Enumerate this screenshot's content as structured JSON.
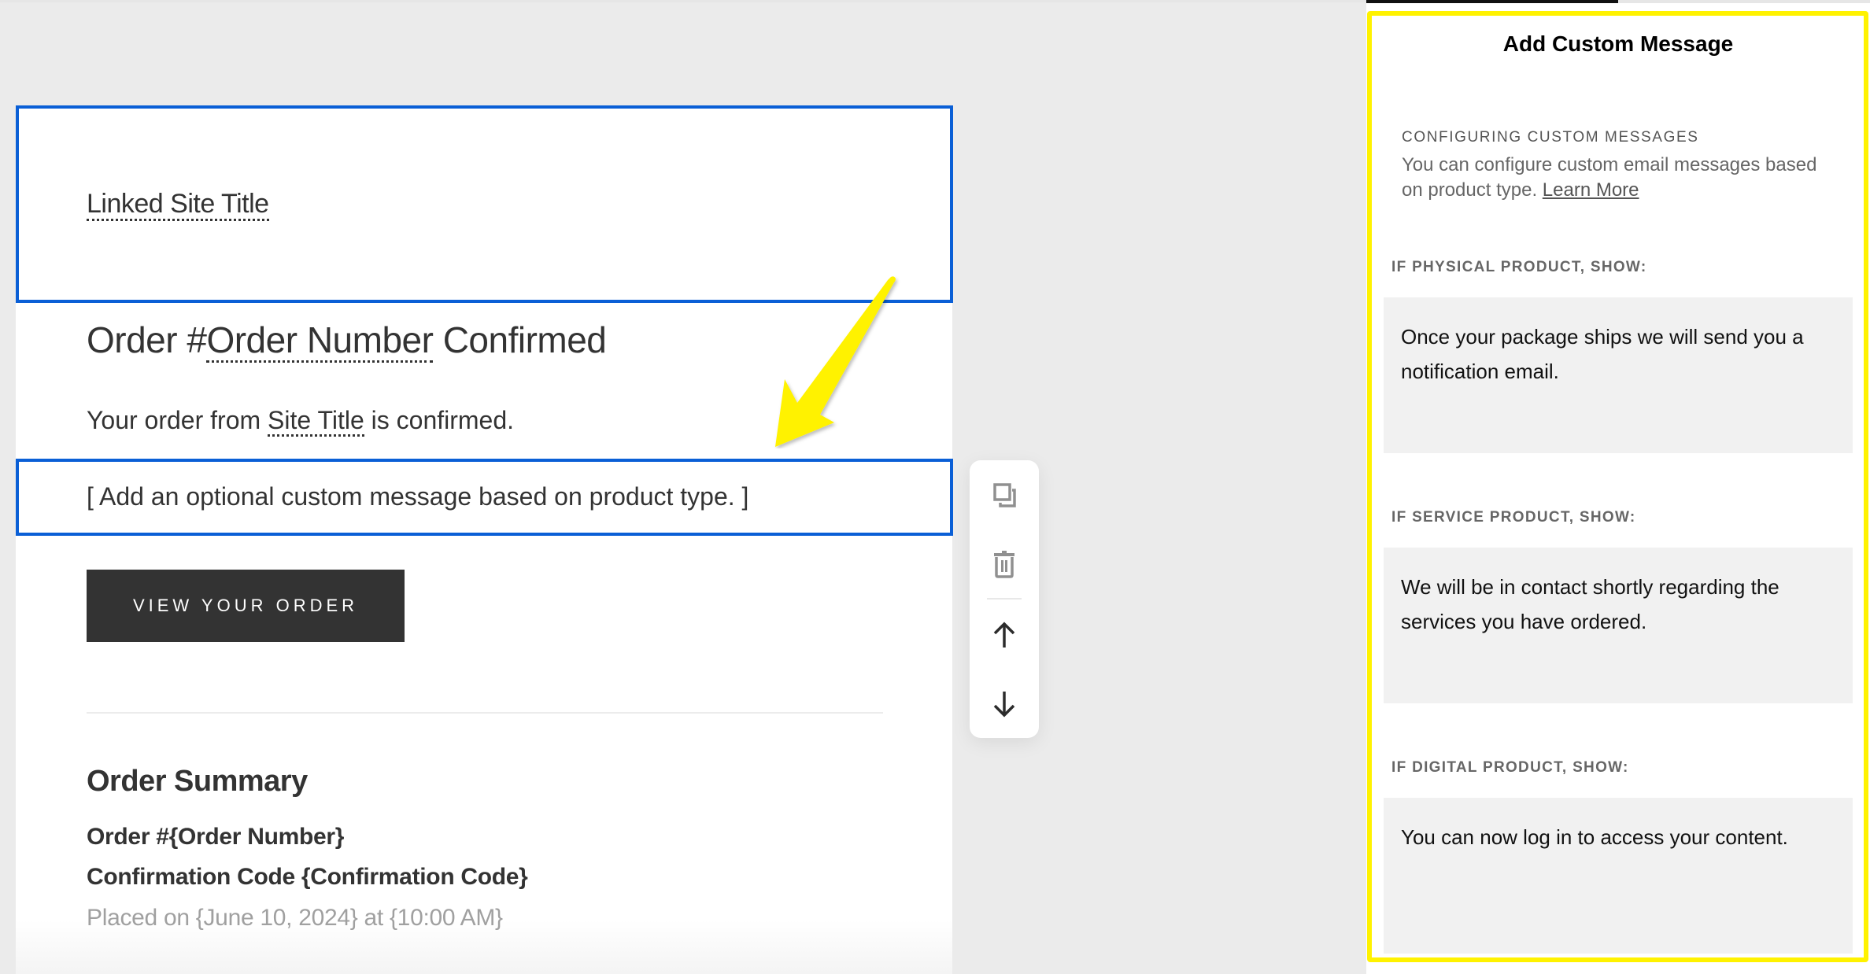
{
  "email_preview": {
    "site_title": "Linked Site Title",
    "order_title": {
      "prefix": "Order #",
      "variable": "Order Number",
      "suffix": " Confirmed"
    },
    "order_sub": {
      "prefix": "Your order from ",
      "variable": "Site Title",
      "suffix": " is confirmed."
    },
    "custom_message_placeholder": "[ Add an optional custom message based on product type. ]",
    "view_order_button": "VIEW YOUR ORDER",
    "order_summary": {
      "heading": "Order Summary",
      "order_number_line": "Order #{Order Number}",
      "confirmation_line": "Confirmation Code {Confirmation Code}",
      "placed_on_line": "Placed on {June 10, 2024} at {10:00 AM}"
    }
  },
  "block_toolbar": {
    "items": [
      {
        "icon": "duplicate-icon",
        "label": "Duplicate"
      },
      {
        "icon": "trash-icon",
        "label": "Delete"
      },
      {
        "icon": "arrow-up-icon",
        "label": "Move up"
      },
      {
        "icon": "arrow-down-icon",
        "label": "Move down"
      }
    ]
  },
  "panel": {
    "title": "Add Custom Message",
    "info_heading": "CONFIGURING CUSTOM MESSAGES",
    "info_text": "You can configure custom email messages based on product type. ",
    "learn_more": "Learn More",
    "sections": [
      {
        "label": "IF PHYSICAL PRODUCT, SHOW:",
        "message": "Once your package ships we will send you a notification email."
      },
      {
        "label": "IF SERVICE PRODUCT, SHOW:",
        "message": "We will be in contact shortly regarding the services you have ordered."
      },
      {
        "label": "IF DIGITAL PRODUCT, SHOW:",
        "message": "You can now log in to access your content."
      }
    ]
  },
  "colors": {
    "selection_blue": "#0a5fd6",
    "annotation_yellow": "#fff200",
    "button_dark": "#333333",
    "canvas_bg": "#ebebeb",
    "message_box_bg": "#f1f1f1"
  }
}
